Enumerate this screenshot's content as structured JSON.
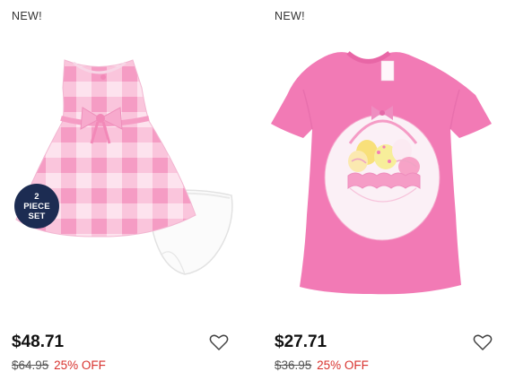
{
  "products": [
    {
      "new_label": "NEW!",
      "badge_lines": [
        "2",
        "PIECE",
        "SET"
      ],
      "price": "$48.71",
      "original_price": "$64.95",
      "discount": "25% OFF",
      "colors": {
        "gingham_pink": "#f7a8cb",
        "gingham_light": "#fde3ee",
        "badge": "#1c2c52"
      }
    },
    {
      "new_label": "NEW!",
      "price": "$27.71",
      "original_price": "$36.95",
      "discount": "25% OFF",
      "colors": {
        "tee_pink": "#f27ab5"
      }
    }
  ],
  "colors": {
    "discount_red": "#d8322e",
    "price_text": "#111111"
  }
}
